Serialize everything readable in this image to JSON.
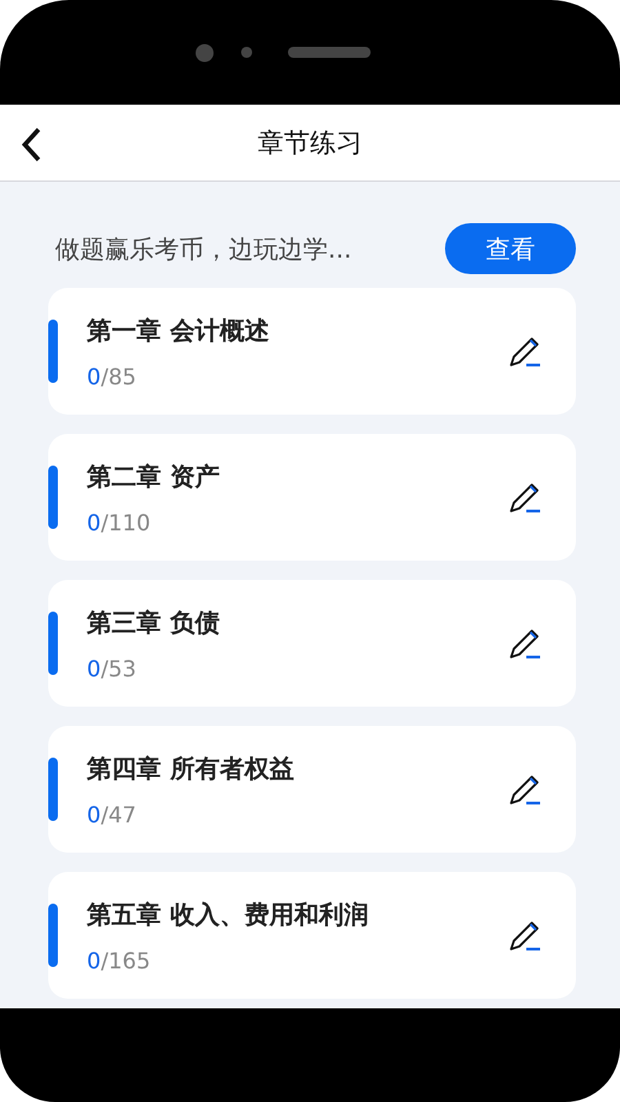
{
  "header": {
    "title": "章节练习"
  },
  "promo": {
    "text": "做题赢乐考币，边玩边学...",
    "button": "查看"
  },
  "chapters": [
    {
      "title": "第一章 会计概述",
      "done": "0",
      "total": "/85"
    },
    {
      "title": "第二章 资产",
      "done": "0",
      "total": "/110"
    },
    {
      "title": "第三章 负债",
      "done": "0",
      "total": "/53"
    },
    {
      "title": "第四章 所有者权益",
      "done": "0",
      "total": "/47"
    },
    {
      "title": "第五章 收入、费用和利润",
      "done": "0",
      "total": "/165"
    }
  ]
}
